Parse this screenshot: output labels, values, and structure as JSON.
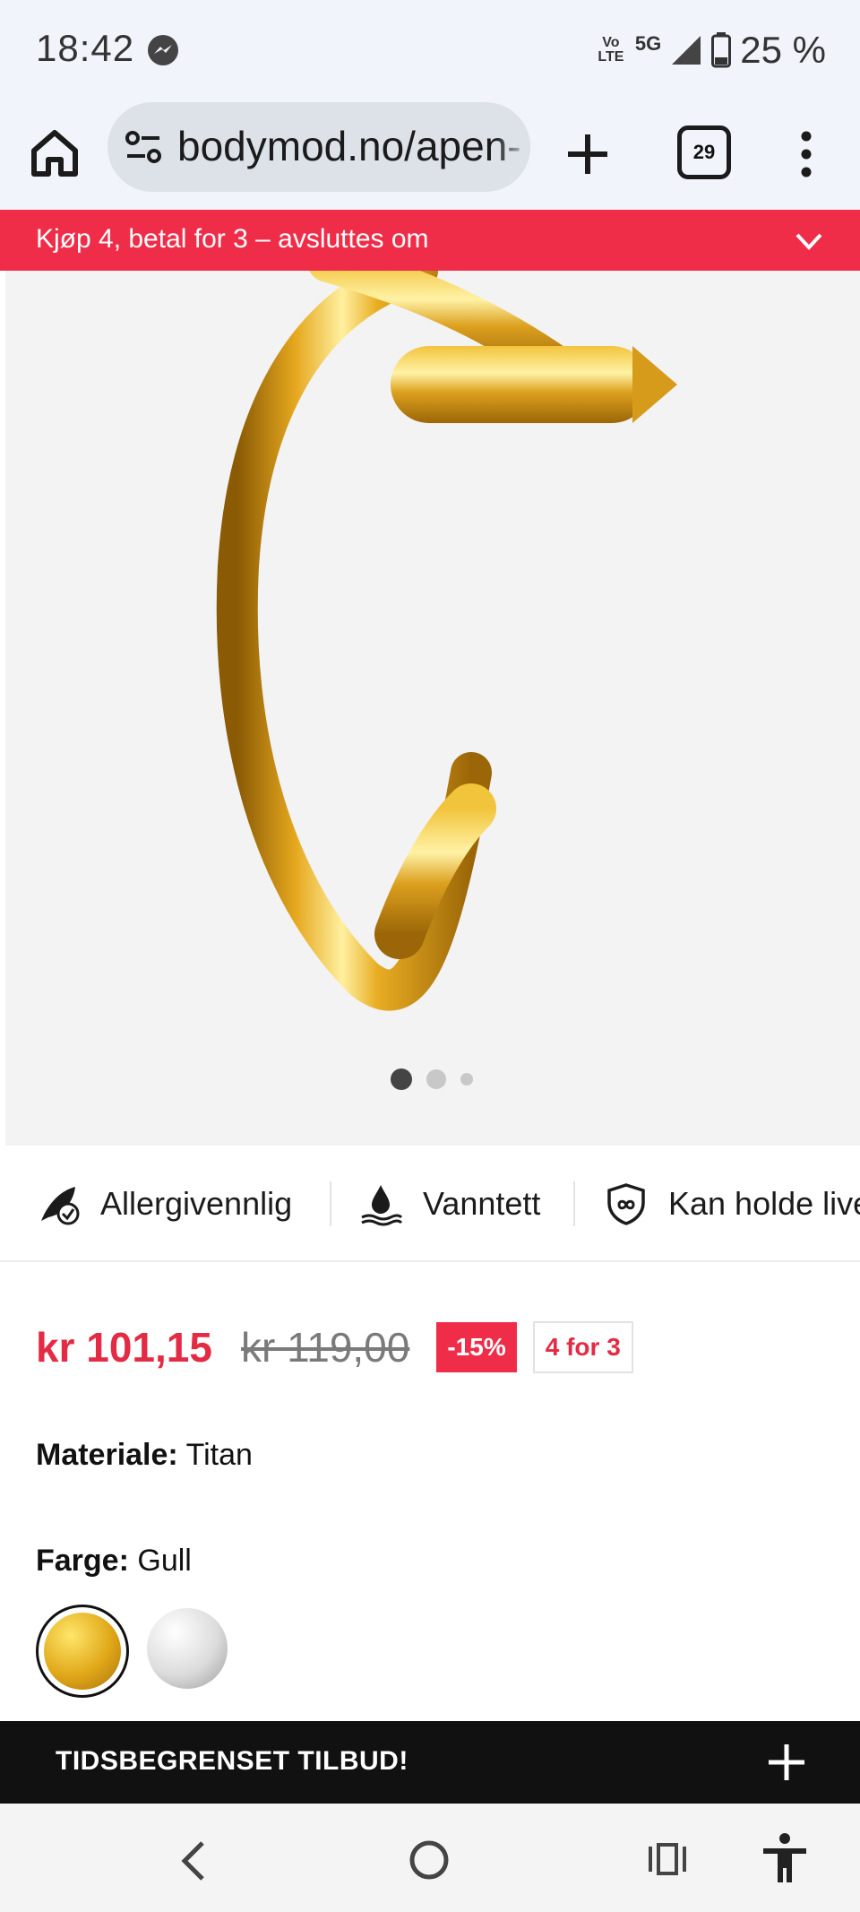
{
  "status_bar": {
    "time": "18:42",
    "network_volte": "Vo LTE",
    "network_type": "5G",
    "battery_percent": "25 %"
  },
  "browser": {
    "url": "bodymod.no/apen-",
    "tab_count": "29"
  },
  "promo": {
    "text": "Kjøp 4, betal for 3 – avsluttes om"
  },
  "gallery": {
    "current_image": 1,
    "total_images": 3
  },
  "features": [
    {
      "label": "Allergivennlig",
      "icon": "feather-check-icon"
    },
    {
      "label": "Vanntett",
      "icon": "water-drop-icon"
    },
    {
      "label": "Kan holde live",
      "icon": "shield-infinity-icon"
    }
  ],
  "price": {
    "current": "kr 101,15",
    "original": "kr 119,00",
    "discount_badge": "-15%",
    "offer_badge": "4 for 3",
    "accent_color": "#e42b45"
  },
  "material": {
    "label": "Materiale:",
    "value": "Titan"
  },
  "color": {
    "label": "Farge:",
    "value": "Gull",
    "options": [
      "gold",
      "silver"
    ],
    "selected": "gold"
  },
  "offer_bar": {
    "text": "TIDSBEGRENSET TILBUD!"
  }
}
